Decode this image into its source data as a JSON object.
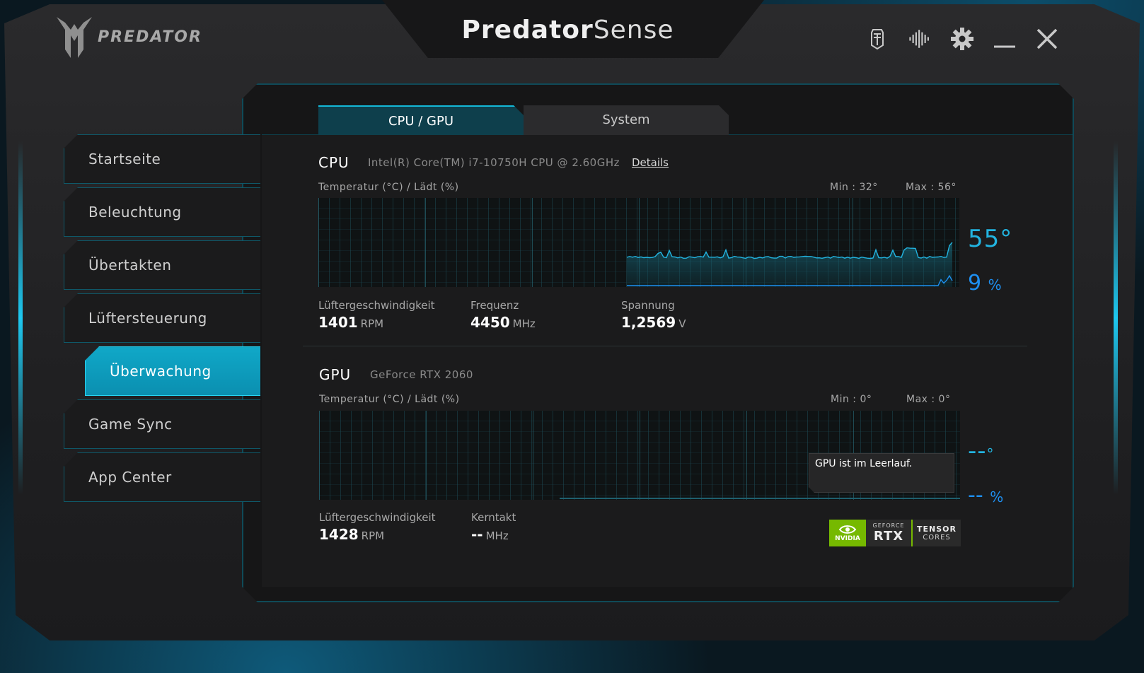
{
  "app": {
    "brand": "PREDATOR",
    "title_bold": "Predator",
    "title_light": "Sense"
  },
  "top_icons": [
    "keyboard-icon",
    "audio-wave-icon",
    "gear-icon",
    "minimize-icon",
    "close-icon"
  ],
  "sidebar": {
    "items": [
      {
        "label": "Startseite"
      },
      {
        "label": "Beleuchtung"
      },
      {
        "label": "Übertakten"
      },
      {
        "label": "Lüftersteuerung"
      },
      {
        "label": "Überwachung",
        "active": true
      },
      {
        "label": "Game Sync"
      },
      {
        "label": "App Center"
      }
    ]
  },
  "tabs": [
    {
      "label": "CPU / GPU",
      "active": true
    },
    {
      "label": "System",
      "active": false
    }
  ],
  "cpu": {
    "title": "CPU",
    "model": "Intel(R) Core(TM) i7-10750H CPU @ 2.60GHz",
    "details_link": "Details",
    "chart_caption": "Temperatur (°C) / Lädt (%)",
    "min": "Min : 32°",
    "max": "Max : 56°",
    "temp_value": "55°",
    "load_value": "9",
    "load_unit": "%",
    "fan_label": "Lüftergeschwindigkeit",
    "fan_value": "1401",
    "fan_unit": "RPM",
    "freq_label": "Frequenz",
    "freq_value": "4450",
    "freq_unit": "MHz",
    "volt_label": "Spannung",
    "volt_value": "1,2569",
    "volt_unit": "V"
  },
  "gpu": {
    "title": "GPU",
    "model": "GeForce RTX 2060",
    "chart_caption": "Temperatur (°C) / Lädt (%)",
    "min": "Min : 0°",
    "max": "Max : 0°",
    "temp_value": "--",
    "temp_unit": "°",
    "load_value": "--",
    "load_unit": "%",
    "fan_label": "Lüftergeschwindigkeit",
    "fan_value": "1428",
    "fan_unit": "RPM",
    "clock_label": "Kerntakt",
    "clock_value": "--",
    "clock_unit": "MHz",
    "idle_tooltip": "GPU ist im Leerlauf.",
    "badge": {
      "nvidia": "NVIDIA",
      "geforce": "GEFORCE",
      "rtx": "RTX",
      "tensor": "TENSOR",
      "cores": "CORES"
    }
  },
  "colors": {
    "accent": "#14b8d8",
    "temp_line": "#22b4e0",
    "load_line": "#1e8ff0",
    "nvidia_green": "#76b900"
  }
}
